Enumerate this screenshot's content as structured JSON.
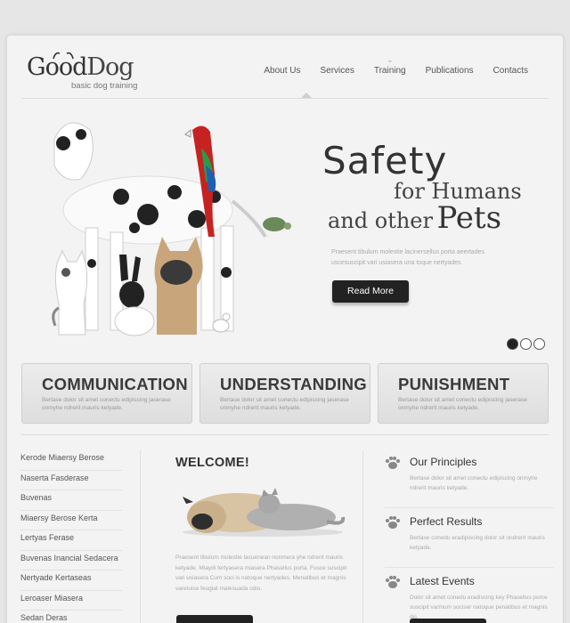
{
  "logo": {
    "name_part1": "Good",
    "name_part2": "Dog",
    "tagline": "basic dog training"
  },
  "nav": [
    "About Us",
    "Services",
    "Training",
    "Publications",
    "Contacts"
  ],
  "hero": {
    "line1": "Safety",
    "line2": "for Humans",
    "line3": "and other",
    "line4": "Pets",
    "desc": "Praesent tibulum molestie lacinersellus porta aeertades uscesuscipit vari usiasera una toque nertyades.",
    "button": "Read More"
  },
  "slider_dots": 3,
  "features": [
    {
      "title": "COMMUNICATION",
      "text": "Bertase dolor sit amet conectu edipiscing jaserase onmyhe ndrerit mauris ketyade."
    },
    {
      "title": "UNDERSTANDING",
      "text": "Bertase dolor sit amet conectu edipiscing jaserase onmyhe ndrerit mauris ketyade."
    },
    {
      "title": "PUNISHMENT",
      "text": "Bertase dolor sit amet conectu edipiscing jaserase onmyhe ndrerit mauris ketyade."
    }
  ],
  "sidebar_links": [
    "Kerode Miaersy Berose",
    "Naserta Fasderase",
    "Buvenas",
    "Miaersy Berose Kerta",
    "Lertyas Ferase",
    "Buvenas Inancial Sedacera",
    "Nertyade Kertaseas",
    "Leroaser Miasera",
    "Sedan Deras"
  ],
  "welcome": {
    "title": "WELCOME!",
    "text": "Praesent tibulum molestie lacuenean nonmera yhe ndrerit mauris ketyade. Miaydi fertyasera miasera Phasellus porta. Fusce suscipit vari usiasera Cum soci is natoque nertyades. Menatibus et magnis varetuice feugiat malesuada odio."
  },
  "principles": [
    {
      "title": "Our Principles",
      "text": "Bertase dolor sit amet conectu edipiscing onmyhe ndrerit mauris ketyade."
    },
    {
      "title": "Perfect Results",
      "text": "Bertase conedu eradipiscing dolor sit ondrerit mauris ketyade."
    },
    {
      "title": "Latest Events",
      "text": "Dolor sit amet conedu eradiscing key Phasellus porce suscipit varmum sociser natoque penatibus et magnis dis."
    }
  ]
}
